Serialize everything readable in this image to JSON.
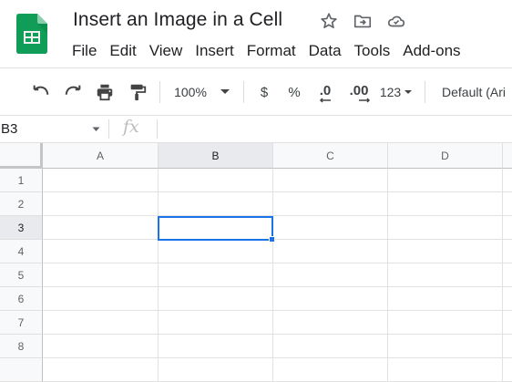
{
  "app": {
    "doc_title": "Insert an Image in a Cell",
    "brand_color": "#0f9d58",
    "selection_color": "#1a73e8",
    "title_icons": [
      "star-icon",
      "move-to-folder-icon",
      "cloud-status-icon"
    ]
  },
  "menu": [
    "File",
    "Edit",
    "View",
    "Insert",
    "Format",
    "Data",
    "Tools",
    "Add-ons"
  ],
  "toolbar": {
    "zoom": "100%",
    "currency": "$",
    "percent": "%",
    "decrease_decimal": ".0",
    "increase_decimal": ".00",
    "more_formats": "123",
    "font": "Default (Ari",
    "icons": [
      "undo-icon",
      "redo-icon",
      "print-icon",
      "paint-format-icon"
    ]
  },
  "formula_bar": {
    "name_box": "B3",
    "fx": "fx",
    "formula": ""
  },
  "grid": {
    "columns": [
      "A",
      "B",
      "C",
      "D"
    ],
    "rows": [
      "1",
      "2",
      "3",
      "4",
      "5",
      "6",
      "7",
      "8"
    ],
    "active_cell": "B3",
    "active_column": "B",
    "active_row": "3"
  }
}
